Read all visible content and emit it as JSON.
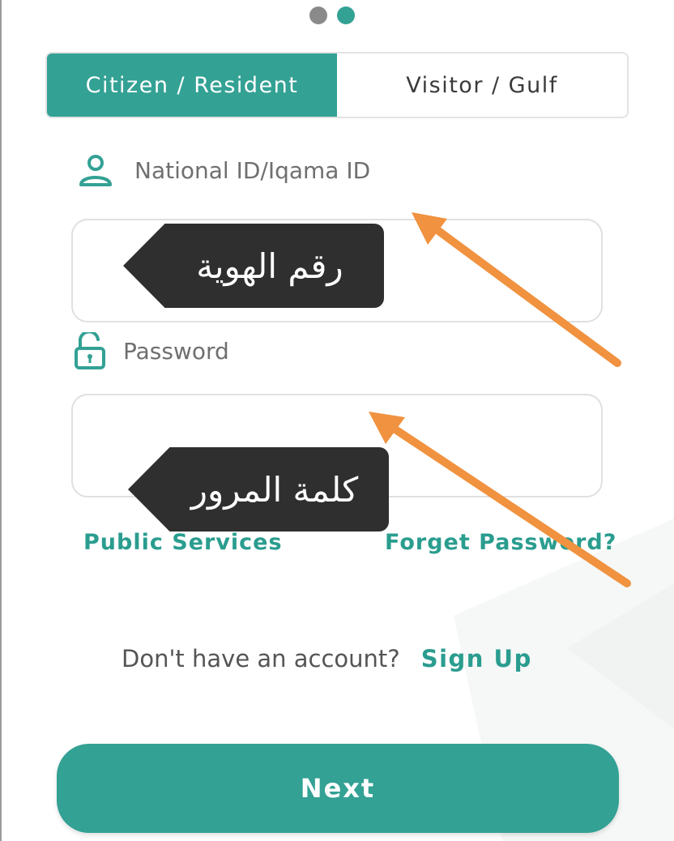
{
  "pager": {
    "dots": 2,
    "active_index": 1
  },
  "tabs": [
    {
      "label": "Citizen / Resident",
      "active": true
    },
    {
      "label": "Visitor / Gulf",
      "active": false
    }
  ],
  "id_field": {
    "label": "National ID/Iqama ID",
    "icon": "user-icon",
    "value": ""
  },
  "password_field": {
    "label": "Password",
    "icon": "unlock-icon",
    "value": ""
  },
  "annotations": {
    "id_tag": "رقم الهوية",
    "password_tag": "كلمة المرور"
  },
  "links": {
    "public_services": "Public Services",
    "forget_password": "Forget Password?"
  },
  "signup": {
    "question": "Don't have an account?",
    "link": "Sign Up"
  },
  "next_button": {
    "label": "Next"
  },
  "colors": {
    "accent": "#33a194",
    "accent_text": "#2a9d8f",
    "annotation_arrow": "#f0923f",
    "annotation_tag_bg": "#2f2f2f",
    "dot_inactive": "#8a8a8a"
  }
}
